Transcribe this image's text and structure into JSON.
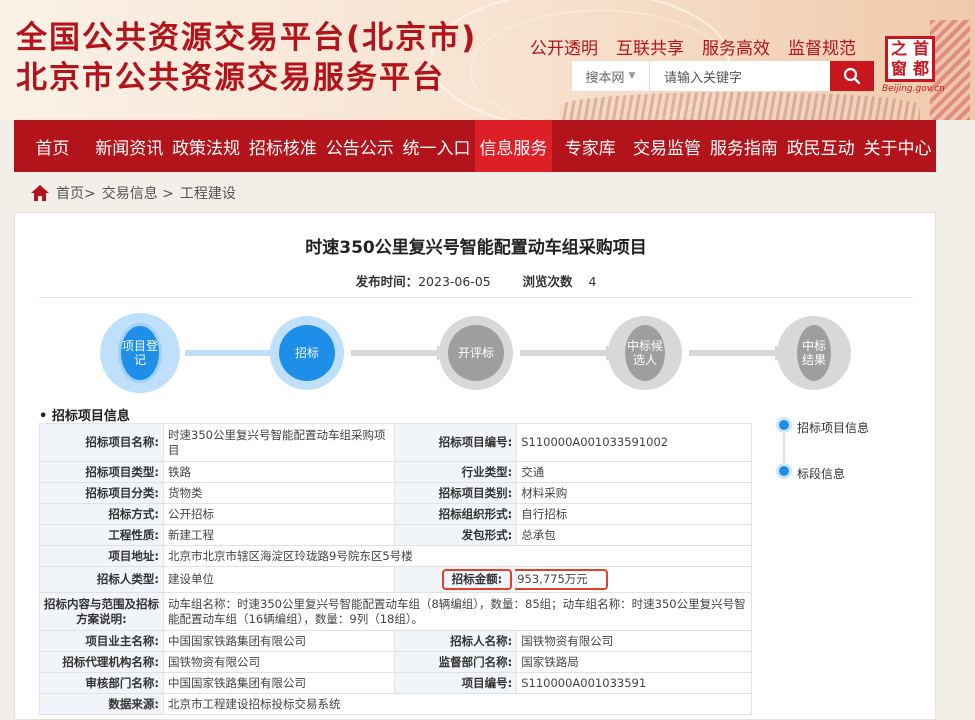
{
  "header": {
    "title_line1": "全国公共资源交易平台(北京市)",
    "title_line2": "北京市公共资源交易服务平台",
    "slogans": [
      "公开透明",
      "互联共享",
      "服务高效",
      "监督规范"
    ],
    "search": {
      "scope": "搜本网",
      "placeholder": "请输入关键字"
    },
    "logo": {
      "chars": [
        "首",
        "之",
        "都",
        "窗"
      ],
      "subtitle": "Beijing.gov.cn"
    }
  },
  "nav": {
    "items": [
      "首页",
      "新闻资讯",
      "政策法规",
      "招标核准",
      "公告公示",
      "统一入口",
      "信息服务",
      "专家库",
      "交易监管",
      "服务指南",
      "政民互动",
      "关于中心"
    ],
    "active": "信息服务"
  },
  "breadcrumb": {
    "home": "首页>",
    "level1": "交易信息 >",
    "level2": "工程建设"
  },
  "project": {
    "title": "时速350公里复兴号智能配置动车组采购项目",
    "publish_label": "发布时间：",
    "publish_date": "2023-06-05",
    "views_label": "浏览次数",
    "views": "4"
  },
  "steps": [
    {
      "label": "项目登记",
      "state": "done"
    },
    {
      "label": "招标",
      "state": "done"
    },
    {
      "label": "开评标",
      "state": "pending"
    },
    {
      "label": "中标候选人",
      "state": "pending"
    },
    {
      "label": "中标结果",
      "state": "pending"
    }
  ],
  "section": {
    "title": "• 招标项目信息"
  },
  "table": {
    "name_k": "招标项目名称:",
    "name_v": "时速350公里复兴号智能配置动车组采购项目",
    "code_k": "招标项目编号:",
    "code_v": "S110000A001033591002",
    "type_k": "招标项目类型:",
    "type_v": "铁路",
    "industry_k": "行业类型:",
    "industry_v": "交通",
    "category_k": "招标项目分类:",
    "category_v": "货物类",
    "kind_k": "招标项目类别:",
    "kind_v": "材料采购",
    "method_k": "招标方式:",
    "method_v": "公开招标",
    "org_k": "招标组织形式:",
    "org_v": "自行招标",
    "nature_k": "工程性质:",
    "nature_v": "新建工程",
    "contract_k": "发包形式:",
    "contract_v": "总承包",
    "addr_k": "项目地址:",
    "addr_v": "北京市北京市辖区海淀区玲珑路9号院东区5号楼",
    "tenderer_type_k": "招标人类型:",
    "tenderer_type_v": "建设单位",
    "amount_k": "招标金额:",
    "amount_v": "953,775万元",
    "scope_k1": "招标内容与范围及招标",
    "scope_k2": "方案说明:",
    "scope_v": "动车组名称：时速350公里复兴号智能配置动车组（8辆编组），数量：85组；动车组名称：时速350公里复兴号智能配置动车组（16辆编组），数量：9列（18组）。",
    "owner_k": "项目业主名称:",
    "owner_v": "中国国家铁路集团有限公司",
    "tenderer_k": "招标人名称:",
    "tenderer_v": "国铁物资有限公司",
    "agency_k": "招标代理机构名称:",
    "agency_v": "国铁物资有限公司",
    "supervisor_k": "监督部门名称:",
    "supervisor_v": "国家铁路局",
    "review_k": "审核部门名称:",
    "review_v": "中国国家铁路集团有限公司",
    "pcode_k": "项目编号:",
    "pcode_v": "S110000A001033591",
    "source_k": "数据来源:",
    "source_v": "北京市工程建设招标投标交易系统"
  },
  "sidebar": {
    "items": [
      "招标项目信息",
      "标段信息"
    ]
  },
  "colors": {
    "brand_red": "#b3141b",
    "nav_active": "#dd1f27",
    "step_blue": "#1d8fe9",
    "step_gray": "#9e9e9e",
    "highlight": "#e2402a"
  }
}
